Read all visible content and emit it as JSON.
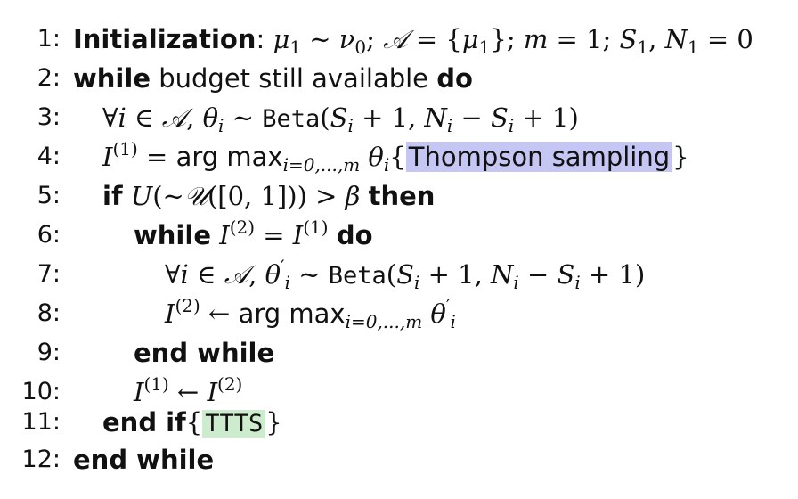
{
  "algorithm": {
    "lines": [
      {
        "num": "1:",
        "keyword": "Initialization",
        "colon": ":"
      },
      {
        "num": "2:",
        "kw_while": "while",
        "text": "budget still available",
        "kw_do": "do"
      },
      {
        "num": "3:",
        "beta": "Beta"
      },
      {
        "num": "4:",
        "argmax": "arg max",
        "sub": "i=0,...,m",
        "comment": "Thompson sampling"
      },
      {
        "num": "5:",
        "kw_if": "if",
        "kw_then": "then"
      },
      {
        "num": "6:",
        "kw_while": "while",
        "kw_do": "do"
      },
      {
        "num": "7:",
        "beta": "Beta"
      },
      {
        "num": "8:",
        "argmax": "arg max",
        "sub": "i=0,...,m"
      },
      {
        "num": "9:",
        "keyword": "end while"
      },
      {
        "num": "10:"
      },
      {
        "num": "11:",
        "keyword": "end if",
        "comment": "TTTS"
      },
      {
        "num": "12:",
        "keyword": "end while"
      }
    ]
  },
  "colors": {
    "thompson_highlight": "#c6c6f5",
    "ttts_highlight": "#cdeccd"
  }
}
